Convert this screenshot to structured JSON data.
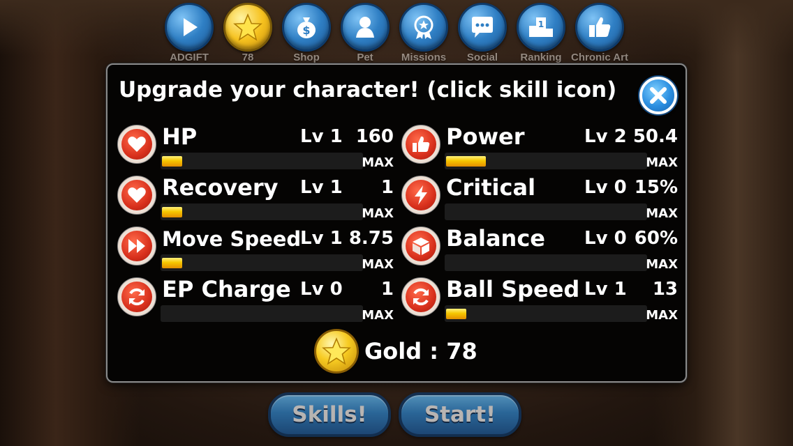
{
  "top_menu": [
    {
      "label": "ADGIFT",
      "icon": "play-icon",
      "style": "blue"
    },
    {
      "label": "78",
      "icon": "star-icon",
      "style": "gold"
    },
    {
      "label": "Shop",
      "icon": "money-bag-icon",
      "style": "blue"
    },
    {
      "label": "Pet",
      "icon": "pet-icon",
      "style": "blue"
    },
    {
      "label": "Missions",
      "icon": "medal-icon",
      "style": "blue"
    },
    {
      "label": "Social",
      "icon": "chat-bubble-icon",
      "style": "blue"
    },
    {
      "label": "Ranking",
      "icon": "podium-icon",
      "style": "blue"
    },
    {
      "label": "Chronic Art",
      "icon": "thumbs-up-icon",
      "style": "blue"
    }
  ],
  "modal": {
    "title": "Upgrade your character! (click skill icon)",
    "close_icon": "close-icon"
  },
  "skills_left": [
    {
      "name": "HP",
      "level": "Lv 1",
      "value": "160",
      "max": "MAX",
      "progress": 0.1,
      "icon": "heart-icon"
    },
    {
      "name": "Recovery",
      "level": "Lv 1",
      "value": "1",
      "max": "MAX",
      "progress": 0.1,
      "icon": "heart-icon"
    },
    {
      "name": "Move Speed",
      "level": "Lv 1",
      "value": "8.75",
      "max": "MAX",
      "progress": 0.1,
      "icon": "fast-forward-icon"
    },
    {
      "name": "EP Charge",
      "level": "Lv 0",
      "value": "1",
      "max": "MAX",
      "progress": 0,
      "icon": "refresh-icon"
    }
  ],
  "skills_right": [
    {
      "name": "Power",
      "level": "Lv 2",
      "value": "50.4",
      "max": "MAX",
      "progress": 0.2,
      "icon": "thumbs-up-icon"
    },
    {
      "name": "Critical",
      "level": "Lv 0",
      "value": "15%",
      "max": "MAX",
      "progress": 0,
      "icon": "lightning-icon"
    },
    {
      "name": "Balance",
      "level": "Lv 0",
      "value": "60%",
      "max": "MAX",
      "progress": 0,
      "icon": "cube-icon"
    },
    {
      "name": "Ball Speed",
      "level": "Lv 1",
      "value": "13",
      "max": "MAX",
      "progress": 0.1,
      "icon": "refresh-icon"
    }
  ],
  "gold": {
    "text": "Gold : 78",
    "icon": "gold-star-coin-icon"
  },
  "buttons": {
    "skills": "Skills!",
    "start": "Start!"
  },
  "colors": {
    "accent_blue": "#2b7fc4",
    "gold": "#f6c600",
    "skill_red": "#d8301c"
  }
}
